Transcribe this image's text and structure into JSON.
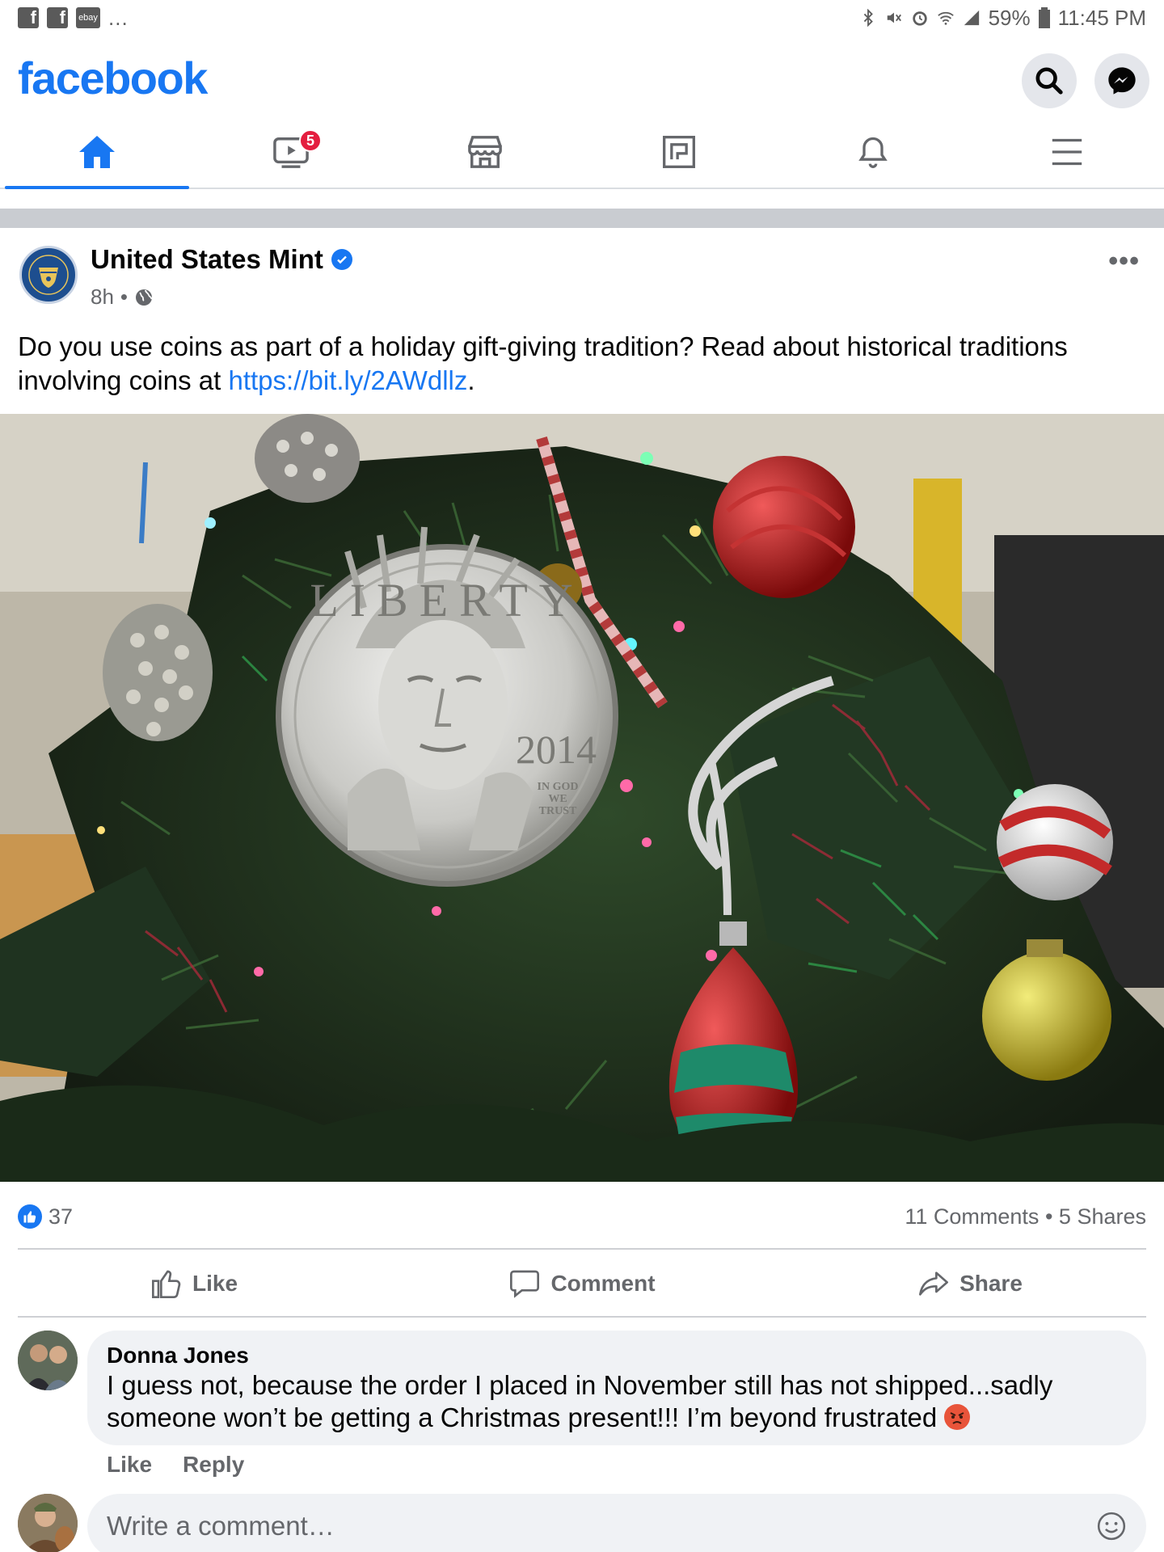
{
  "status_bar": {
    "left_icons": [
      "facebook-app-icon",
      "facebook-app-icon",
      "ebay-app-icon"
    ],
    "ebay_label": "ebay",
    "more_dots": "...",
    "battery": "59%",
    "time": "11:45 PM"
  },
  "header": {
    "logo": "facebook"
  },
  "nav": {
    "tabs": [
      "home",
      "watch",
      "marketplace",
      "pages",
      "notifications",
      "menu"
    ],
    "watch_badge": "5"
  },
  "post": {
    "page_name": "United States Mint",
    "time": "8h",
    "separator": "•",
    "more": "•••",
    "text_before_link": "Do you use coins as part of a holiday gift-giving tradition? Read about historical traditions involving coins at ",
    "link": "https://bit.ly/2AWdllz",
    "text_after_link": ".",
    "coin": {
      "legend": "LIBERTY",
      "year": "2014",
      "motto_1": "IN GOD",
      "motto_2": "WE",
      "motto_3": "TRUST"
    }
  },
  "reactions": {
    "like_count": "37",
    "comments": "11 Comments",
    "dot": "•",
    "shares": "5 Shares"
  },
  "actions": {
    "like": "Like",
    "comment": "Comment",
    "share": "Share"
  },
  "comment": {
    "author": "Donna Jones",
    "text": "I guess not, because the order I placed in November still has not shipped...sadly someone won’t be getting a Christmas present!!!  I’m beyond frustrated ",
    "like": "Like",
    "reply": "Reply"
  },
  "composer": {
    "placeholder": "Write a comment…"
  },
  "colors": {
    "brand": "#1877f2",
    "secondary_text": "#65676b",
    "notification_badge": "#e41e3f"
  }
}
